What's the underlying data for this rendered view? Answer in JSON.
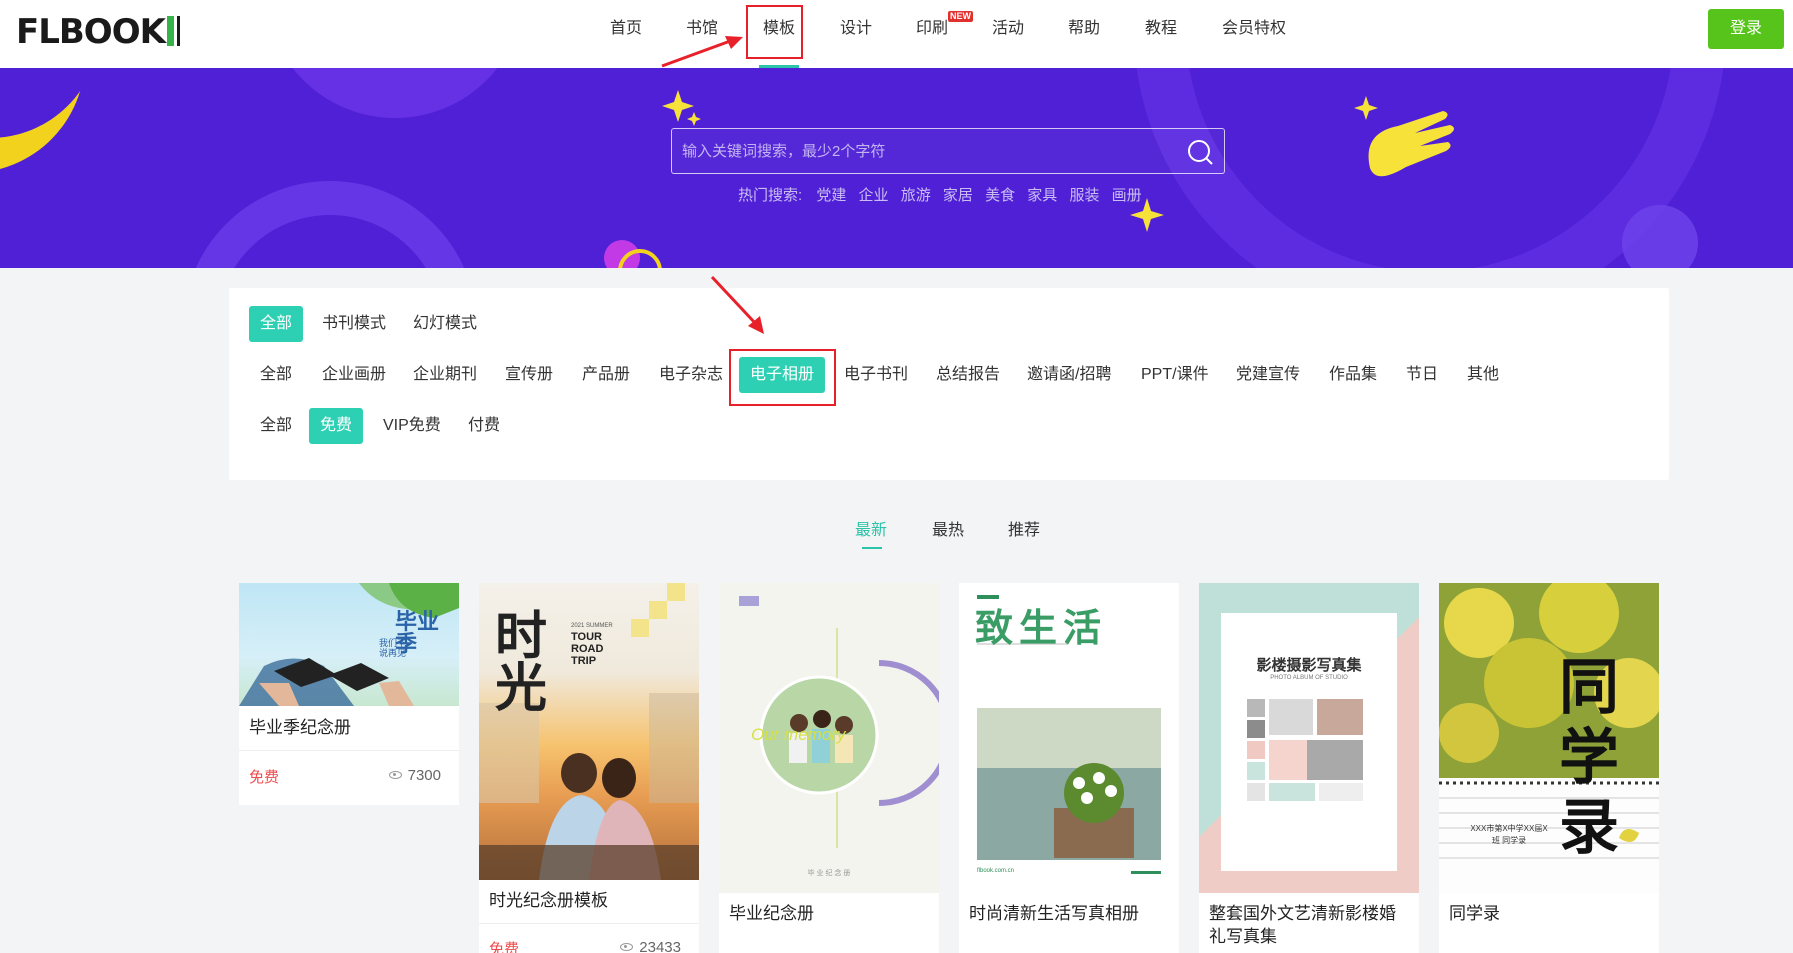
{
  "header": {
    "logo": "FLBOOK",
    "nav": [
      "首页",
      "书馆",
      "模板",
      "设计",
      "印刷",
      "活动",
      "帮助",
      "教程",
      "会员特权"
    ],
    "new_badge": "NEW",
    "login": "登录"
  },
  "hero": {
    "search_placeholder": "输入关键词搜索，最少2个字符",
    "hot_label": "热门搜索:",
    "hot_terms": [
      "党建",
      "企业",
      "旅游",
      "家居",
      "美食",
      "家具",
      "服装",
      "画册"
    ]
  },
  "filters": {
    "mode": [
      "全部",
      "书刊模式",
      "幻灯模式"
    ],
    "category": [
      "全部",
      "企业画册",
      "企业期刊",
      "宣传册",
      "产品册",
      "电子杂志",
      "电子相册",
      "电子书刊",
      "总结报告",
      "邀请函/招聘",
      "PPT/课件",
      "党建宣传",
      "作品集",
      "节日",
      "其他"
    ],
    "price": [
      "全部",
      "免费",
      "VIP免费",
      "付费"
    ]
  },
  "sort_tabs": [
    "最新",
    "最热",
    "推荐"
  ],
  "cards": [
    {
      "title": "毕业季纪念册",
      "price": "免费",
      "views": "7300",
      "cover_text": "毕业季",
      "cover_sub": "我们不说再见"
    },
    {
      "title": "时光纪念册模板",
      "price": "免费",
      "views": "23433",
      "cover_text": "时光",
      "cover_sub": "TOUR ROAD TRIP",
      "cover_year": "2021 SUMMER"
    },
    {
      "title": "毕业纪念册",
      "price": "",
      "views": "",
      "cover_text": "Our memory",
      "cover_sub": "毕 业 纪 念 册"
    },
    {
      "title": "时尚清新生活写真相册",
      "price": "",
      "views": "",
      "cover_text": "致生活",
      "cover_sub": "flbook.com.cn"
    },
    {
      "title": "整套国外文艺清新影楼婚礼写真集",
      "price": "",
      "views": "",
      "cover_text": "影楼摄影写真集",
      "cover_sub": "PHOTO ALBUM OF STUDIO"
    },
    {
      "title": "同学录",
      "price": "",
      "views": "",
      "cover_text": "同学录",
      "cover_sub": "XXX市第X中学XX届X班 同学录"
    }
  ]
}
